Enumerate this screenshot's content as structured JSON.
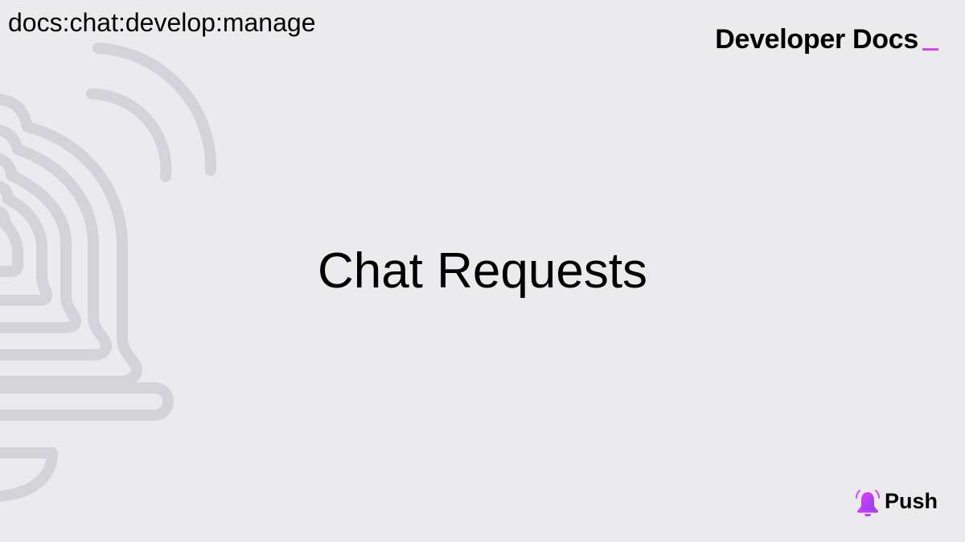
{
  "page": {
    "breadcrumb": "docs:chat:develop:manage",
    "brand_title": "Developer Docs",
    "title": "Chat Requests"
  },
  "logo": {
    "text": "Push",
    "icon": "bell-icon"
  },
  "colors": {
    "background": "#ebebee",
    "art_stroke": "#d4d3da",
    "accent": "#d548ec",
    "logo_gradient_start": "#e040fb",
    "logo_gradient_end": "#8f3ff0"
  }
}
